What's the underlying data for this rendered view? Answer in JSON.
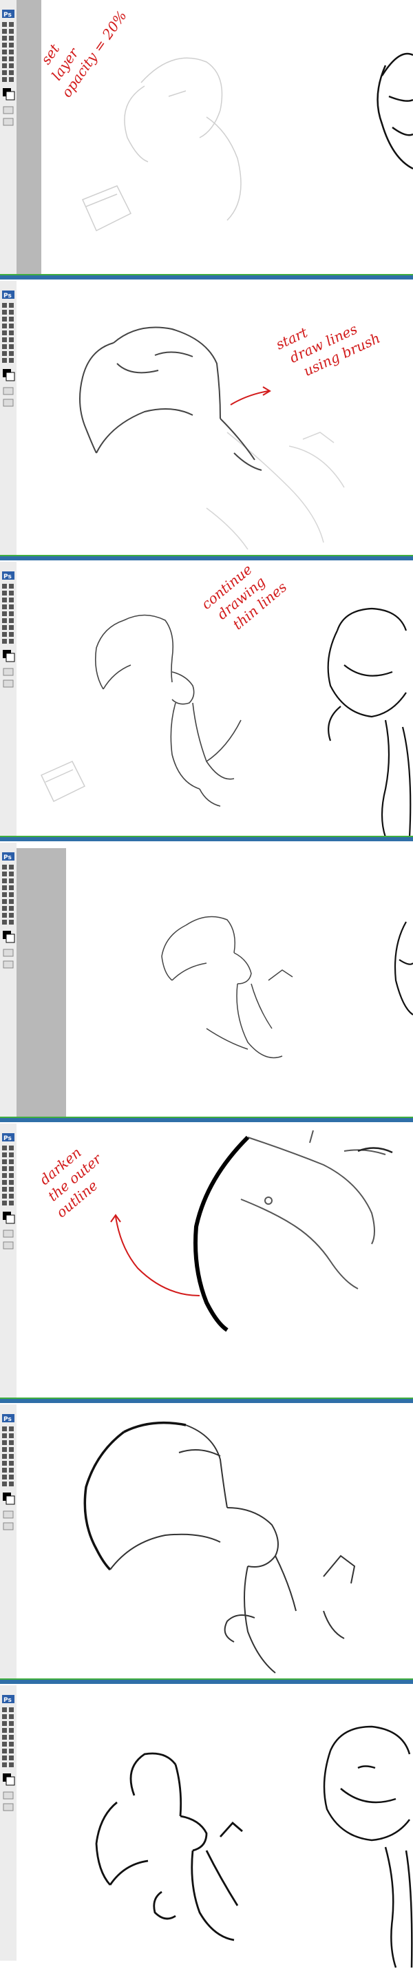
{
  "app": {
    "badge": "Ps"
  },
  "colors": {
    "taskbar": "#2f6fa8",
    "taskbar_stripe": "#3fae3f",
    "toolbar_bg": "#ececec",
    "canvas_grey": "#b8b8b8",
    "annotation_red": "#d21a1a",
    "sketch_faint": "#c8c8c8",
    "line_dark": "#111111"
  },
  "tools": [
    "move-tool",
    "marquee-tool",
    "lasso-tool",
    "wand-tool",
    "crop-tool",
    "slice-tool",
    "heal-tool",
    "brush-tool",
    "stamp-tool",
    "history-brush-tool",
    "eraser-tool",
    "gradient-tool",
    "dodge-tool",
    "pen-tool",
    "type-tool",
    "path-select-tool",
    "shape-tool",
    "notes-tool",
    "eyedropper-tool",
    "hand-tool",
    "zoom-tool"
  ],
  "panels": [
    {
      "step": 1,
      "annotation_lines": [
        "set",
        "layer",
        "opacity = 20%"
      ]
    },
    {
      "step": 2,
      "annotation_lines": [
        "start",
        "draw lines",
        "using brush"
      ]
    },
    {
      "step": 3,
      "annotation_lines": [
        "continue",
        "drawing",
        "thin lines"
      ]
    },
    {
      "step": 4,
      "annotation_lines": []
    },
    {
      "step": 5,
      "annotation_lines": [
        "darken",
        "the outer",
        "outline"
      ]
    },
    {
      "step": 6,
      "annotation_lines": []
    },
    {
      "step": 7,
      "annotation_lines": []
    }
  ]
}
